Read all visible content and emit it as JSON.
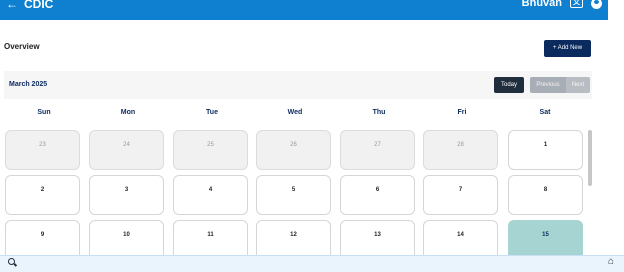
{
  "app": {
    "title": "CDIC",
    "back_icon": "←"
  },
  "user": {
    "name": "Bhuvan",
    "translate_icon": "translate-icon",
    "profile_icon": "user-icon"
  },
  "page": {
    "title": "Overview",
    "add_label": "+ Add New"
  },
  "calendar": {
    "month_label": "March 2025",
    "buttons": {
      "today": "Today",
      "previous": "Previous",
      "next": "Next"
    },
    "weekdays": [
      "Sun",
      "Mon",
      "Tue",
      "Wed",
      "Thu",
      "Fri",
      "Sat"
    ],
    "weeks": [
      [
        "23",
        "24",
        "25",
        "26",
        "27",
        "28",
        "1"
      ],
      [
        "2",
        "3",
        "4",
        "5",
        "6",
        "7",
        "8"
      ],
      [
        "9",
        "10",
        "11",
        "12",
        "13",
        "14",
        "15"
      ]
    ],
    "other_month_days": [
      "23",
      "24",
      "25",
      "26",
      "27",
      "28"
    ],
    "today": "15"
  },
  "bottom": {
    "search_icon": "search-icon",
    "home_icon": "home-icon"
  },
  "colors": {
    "header": "#0f7fcf",
    "accent": "#0b2a5e",
    "today": "#a6d4d2"
  }
}
